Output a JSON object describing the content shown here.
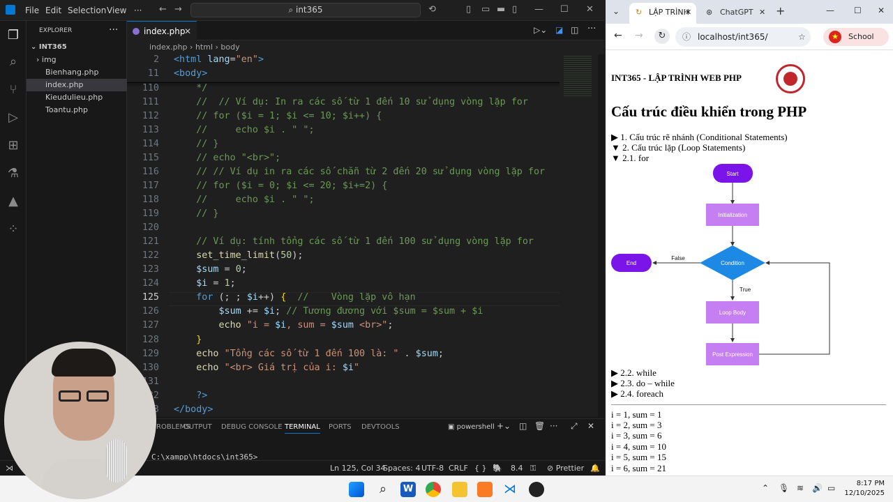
{
  "vscode": {
    "menu": [
      "File",
      "Edit",
      "Selection",
      "View",
      "···"
    ],
    "search": "int365",
    "explorer_title": "EXPLORER",
    "explorer_menu": "···",
    "project": "INT365",
    "files": [
      "img",
      "Bienhang.php",
      "index.php",
      "Kieudulieu.php",
      "Toantu.php"
    ],
    "selected_file": "index.php",
    "tab": "index.php",
    "breadcrumb": [
      "index.php",
      "html",
      "body"
    ],
    "sticky": [
      {
        "ln": "2",
        "html": "<span class=\"tg\">&lt;html</span> <span class=\"at\">lang</span>=<span class=\"s\">\"en\"</span><span class=\"tg\">&gt;</span>"
      },
      {
        "ln": "11",
        "html": "<span class=\"tg\">&lt;body&gt;</span>"
      }
    ],
    "lines": [
      {
        "ln": "110",
        "html": "    <span class=\"c\">*/</span>"
      },
      {
        "ln": "111",
        "html": "    <span class=\"c\">//  // Ví dụ: In ra các số từ 1 đến 10 sử dụng vòng lặp for</span>"
      },
      {
        "ln": "112",
        "html": "    <span class=\"c\">// for ($i = 1; $i &lt;= 10; $i++) {</span>"
      },
      {
        "ln": "113",
        "html": "    <span class=\"c\">//     echo $i . \" \";</span>"
      },
      {
        "ln": "114",
        "html": "    <span class=\"c\">// }</span>"
      },
      {
        "ln": "115",
        "html": "    <span class=\"c\">// echo \"&lt;br&gt;\";</span>"
      },
      {
        "ln": "116",
        "html": "    <span class=\"c\">// // Ví dụ in ra các số chẵn từ 2 đến 20 sử dụng vòng lặp for</span>"
      },
      {
        "ln": "117",
        "html": "    <span class=\"c\">// for ($i = 0; $i &lt;= 20; $i+=2) {</span>"
      },
      {
        "ln": "118",
        "html": "    <span class=\"c\">//     echo $i . \" \";</span>"
      },
      {
        "ln": "119",
        "html": "    <span class=\"c\">// }</span>"
      },
      {
        "ln": "120",
        "html": ""
      },
      {
        "ln": "121",
        "html": "    <span class=\"c\">// Ví dụ: tính tổng các số từ 1 đến 100 sử dụng vòng lặp for</span>"
      },
      {
        "ln": "122",
        "html": "    <span class=\"f\">set_time_limit</span>(<span class=\"n\">50</span>);"
      },
      {
        "ln": "123",
        "html": "    <span class=\"v\">$sum</span> = <span class=\"n\">0</span>;"
      },
      {
        "ln": "124",
        "html": "    <span class=\"v\">$i</span> = <span class=\"n\">1</span>;"
      },
      {
        "ln": "125",
        "html": "    <span class=\"k\">for</span> (; ; <span class=\"v\">$i</span>++) <span class=\"y\">{</span>  <span class=\"c\">//    Vòng lặp vô hạn</span>"
      },
      {
        "ln": "126",
        "html": "        <span class=\"v\">$sum</span> += <span class=\"v\">$i</span>; <span class=\"c\">// Tương đương với $sum = $sum + $i</span>"
      },
      {
        "ln": "127",
        "html": "        <span class=\"f\">echo</span> <span class=\"s\">\"i = </span><span class=\"v\">$i</span><span class=\"s\">, sum = </span><span class=\"v\">$sum</span><span class=\"s\"> &lt;br&gt;\"</span>;"
      },
      {
        "ln": "128",
        "html": "    <span class=\"y\">}</span>"
      },
      {
        "ln": "129",
        "html": "    <span class=\"f\">echo</span> <span class=\"s\">\"Tổng các số từ 1 đến 100 là: \"</span> . <span class=\"v\">$sum</span>;"
      },
      {
        "ln": "130",
        "html": "    <span class=\"f\">echo</span> <span class=\"s\">\"&lt;br&gt; Giá trị của i: </span><span class=\"v\">$i</span><span class=\"s\">\"</span>"
      },
      {
        "ln": "131",
        "html": ""
      },
      {
        "ln": "132",
        "html": "    <span class=\"k\">?&gt;</span>"
      },
      {
        "ln": "133",
        "html": "<span class=\"tg\">&lt;/body&gt;</span>"
      }
    ],
    "current_line": "125",
    "panel_tabs": [
      "PROBLEMS",
      "OUTPUT",
      "DEBUG CONSOLE",
      "TERMINAL",
      "PORTS",
      "DEVTOOLS"
    ],
    "active_panel": "TERMINAL",
    "terminal_name": "powershell",
    "terminal_prompt": "C:\\xampp\\htdocs\\int365>",
    "status": {
      "position": "Ln 125, Col 34",
      "spaces": "Spaces: 4",
      "encoding": "UTF-8",
      "eol": "CRLF",
      "lang": "{ }",
      "php": "8.4",
      "prettier": "Prettier"
    }
  },
  "chrome": {
    "tab1": "LẬP TRÌNH",
    "tab2": "ChatGPT",
    "url": "localhost/int365/",
    "profile": "School",
    "page": {
      "header": "INT365 - LẬP TRÌNH WEB PHP",
      "heading": "Cấu trúc điều khiển trong PHP",
      "details": [
        {
          "marker": "▶",
          "text": "1. Cấu trúc rẽ nhánh (Conditional Statements)"
        },
        {
          "marker": "▼",
          "text": "2. Cấu trúc lặp (Loop Statements)"
        },
        {
          "marker": "▼",
          "text": "2.1. for"
        }
      ],
      "flow": {
        "start": "Start",
        "init": "Initialization",
        "cond": "Condition",
        "end": "End",
        "body": "Loop Body",
        "post": "Post Expression",
        "false_label": "False",
        "true_label": "True"
      },
      "details2": [
        {
          "marker": "▶",
          "text": "2.2. while"
        },
        {
          "marker": "▶",
          "text": "2.3. do – while"
        },
        {
          "marker": "▶",
          "text": "2.4. foreach"
        }
      ],
      "output": [
        "i = 1, sum = 1",
        "i = 2, sum = 3",
        "i = 3, sum = 6",
        "i = 4, sum = 10",
        "i = 5, sum = 15",
        "i = 6, sum = 21"
      ]
    }
  },
  "taskbar": {
    "time": "8:17 PM",
    "date": "12/10/2025"
  }
}
